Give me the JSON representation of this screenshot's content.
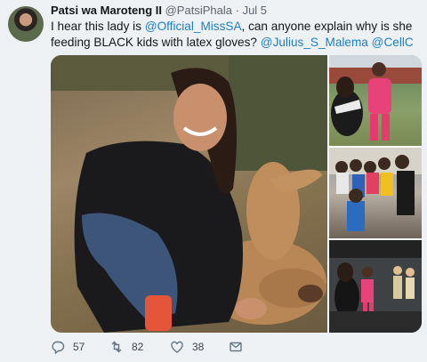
{
  "tweet": {
    "author_name": "Patsi wa Maroteng II",
    "handle": "@PatsiPhala",
    "separator": "·",
    "time": "Jul 5",
    "text_before": "I hear this lady is ",
    "mention_1": "@Official_MissSA",
    "text_middle": ", can anyone explain why is she feeding BLACK kids with latex gloves? ",
    "mention_2": "@Julius_S_Malema",
    "text_space": " ",
    "mention_3": "@CellC"
  },
  "actions": {
    "reply_count": "57",
    "retweet_count": "82",
    "like_count": "38"
  },
  "icons": [
    "reply-icon",
    "retweet-icon",
    "like-icon",
    "message-icon"
  ],
  "colors": {
    "link": "#1d7fc2",
    "name": "#14171a",
    "meta": "#5b6670"
  }
}
